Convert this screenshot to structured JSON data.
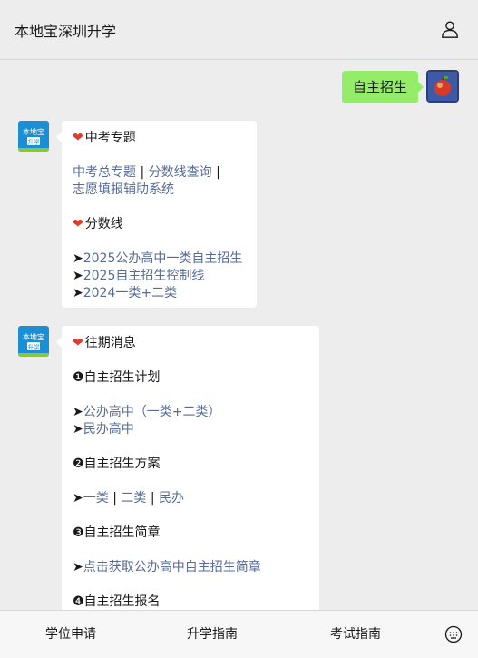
{
  "header": {
    "title": "本地宝深圳升学",
    "profile_icon": "person-icon"
  },
  "outgoing": {
    "text": "自主招生"
  },
  "bot": {
    "avatar_line1": "本地宝",
    "avatar_line2": "升学"
  },
  "msg1": {
    "h1": "中考专题",
    "links_row1": [
      "中考总专题",
      "分数线查询"
    ],
    "links_row2": "志愿填报辅助系统",
    "h2": "分数线",
    "items": [
      "2025公办高中一类自主招生",
      "2025自主招生控制线",
      "2024一类+二类"
    ]
  },
  "msg2": {
    "h1": "往期消息",
    "s1": "❶自主招生计划",
    "s1_items": [
      "公办高中（一类+二类）",
      "民办高中"
    ],
    "s2": "❷自主招生方案",
    "s2_links": [
      "一类",
      "二类",
      "民办"
    ],
    "s3": "❸自主招生简章",
    "s3_item": "点击获取公办高中自主招生简章",
    "s4": "❹自主招生报名"
  },
  "footer": {
    "menu": [
      "学位申请",
      "升学指南",
      "考试指南"
    ],
    "keyboard_icon": "keyboard-icon"
  },
  "colors": {
    "link": "#576b95",
    "bubble_out": "#95ec69",
    "heart": "#e03c2c"
  }
}
